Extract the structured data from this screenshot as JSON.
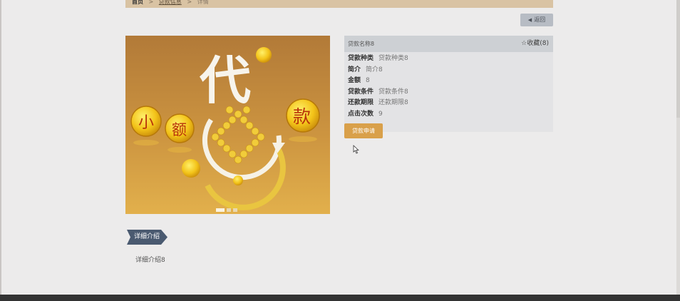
{
  "breadcrumb": {
    "home": "首页",
    "separator": ">",
    "section": "贷款信息",
    "current": "详情"
  },
  "back_button": {
    "label": "返回",
    "icon": "caret-left-icon"
  },
  "product": {
    "image_text": {
      "top": "代",
      "coin_left_1": "小",
      "coin_left_2": "额",
      "coin_right": "款"
    },
    "carousel": {
      "slides": 3,
      "active": 1
    }
  },
  "detail": {
    "name": "贷款名称8",
    "favorite": "☆收藏(8)",
    "rows": [
      {
        "key": "贷款种类",
        "value": "贷款种类8"
      },
      {
        "key": "简介",
        "value": "简介8"
      },
      {
        "key": "金额",
        "value": "8"
      },
      {
        "key": "贷款条件",
        "value": "贷款条件8"
      },
      {
        "key": "还款期限",
        "value": "还款期限8"
      },
      {
        "key": "点击次数",
        "value": "9"
      }
    ],
    "apply_label": "贷款申请"
  },
  "intro": {
    "tab_label": "详细介绍",
    "text": "详细介绍8"
  },
  "colors": {
    "accent": "#d9a04a",
    "breadcrumb_bg": "#d9c3a3",
    "tab_bg": "#4a5a70",
    "footer_bg": "#333333"
  }
}
